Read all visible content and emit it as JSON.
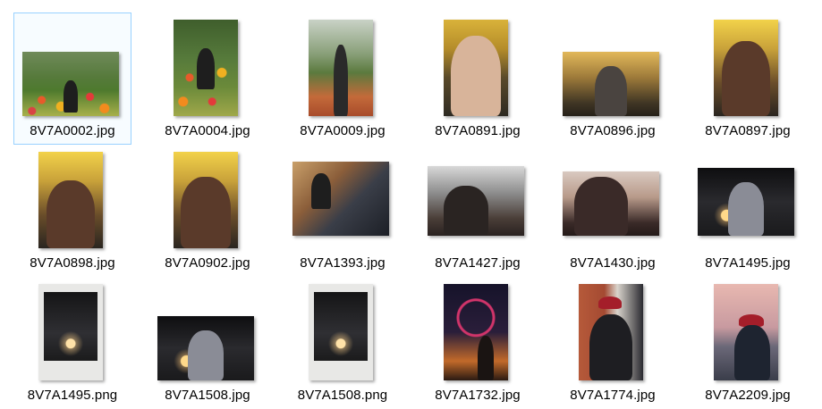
{
  "files": [
    {
      "name": "8V7A0002.jpg",
      "photo": "flowers",
      "selected": true
    },
    {
      "name": "8V7A0004.jpg",
      "photo": "flowers-tall",
      "selected": false
    },
    {
      "name": "8V7A0009.jpg",
      "photo": "park",
      "selected": false
    },
    {
      "name": "8V7A0891.jpg",
      "photo": "autumn",
      "selected": false
    },
    {
      "name": "8V7A0896.jpg",
      "photo": "forest",
      "selected": false
    },
    {
      "name": "8V7A0897.jpg",
      "photo": "yellow",
      "selected": false
    },
    {
      "name": "8V7A0898.jpg",
      "photo": "yellow",
      "selected": false
    },
    {
      "name": "8V7A0902.jpg",
      "photo": "yellow",
      "selected": false
    },
    {
      "name": "8V7A1393.jpg",
      "photo": "stairs",
      "selected": false
    },
    {
      "name": "8V7A1427.jpg",
      "photo": "building",
      "selected": false
    },
    {
      "name": "8V7A1430.jpg",
      "photo": "mask",
      "selected": false
    },
    {
      "name": "8V7A1495.jpg",
      "photo": "night",
      "selected": false
    },
    {
      "name": "8V7A1495.png",
      "photo": "polaroid",
      "selected": false
    },
    {
      "name": "8V7A1508.jpg",
      "photo": "night",
      "selected": false
    },
    {
      "name": "8V7A1508.png",
      "photo": "polaroid",
      "selected": false
    },
    {
      "name": "8V7A1732.jpg",
      "photo": "ferris",
      "selected": false
    },
    {
      "name": "8V7A1774.jpg",
      "photo": "brick",
      "selected": false
    },
    {
      "name": "8V7A2209.jpg",
      "photo": "sunset",
      "selected": false
    }
  ],
  "selection_color": "#99d1ff"
}
